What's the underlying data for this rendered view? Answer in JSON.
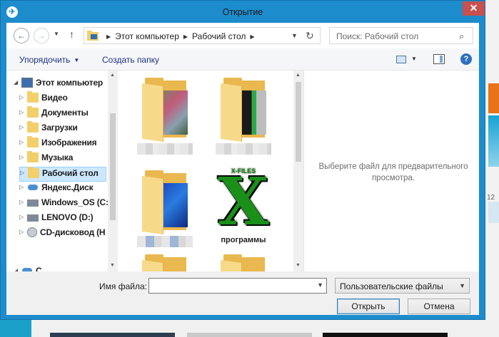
{
  "window": {
    "title": "Открытие"
  },
  "address": {
    "segments": [
      "Этот компьютер",
      "Рабочий стол"
    ],
    "search_placeholder": "Поиск: Рабочий стол"
  },
  "toolbar": {
    "organize": "Упорядочить",
    "new_folder": "Создать папку"
  },
  "tree": {
    "root": "Этот компьютер",
    "items": [
      {
        "label": "Видео",
        "icon": "video-folder-icon"
      },
      {
        "label": "Документы",
        "icon": "documents-folder-icon"
      },
      {
        "label": "Загрузки",
        "icon": "downloads-folder-icon"
      },
      {
        "label": "Изображения",
        "icon": "pictures-folder-icon"
      },
      {
        "label": "Музыка",
        "icon": "music-folder-icon"
      },
      {
        "label": "Рабочий стол",
        "icon": "desktop-folder-icon",
        "selected": true
      },
      {
        "label": "Яндекс.Диск",
        "icon": "cloud-icon"
      },
      {
        "label": "Windows_OS (C:",
        "icon": "drive-icon"
      },
      {
        "label": "LENOVO (D:)",
        "icon": "drive-icon"
      },
      {
        "label": "CD-дисковод (H",
        "icon": "cd-drive-icon"
      }
    ],
    "partial_label": "С"
  },
  "files": [
    {
      "label": "",
      "kind": "folder-photos"
    },
    {
      "label": "",
      "kind": "folder-dark"
    },
    {
      "label": "",
      "kind": "folder-windows"
    },
    {
      "label": "программы",
      "kind": "x-files-icon",
      "icon_text": "X-FILES"
    }
  ],
  "preview": {
    "text": "Выберите файл для предварительного просмотра."
  },
  "bottom": {
    "filename_label": "Имя файла:",
    "filename_value": "",
    "filetype": "Пользовательские файлы",
    "open_button": "Открыть",
    "cancel_button": "Отмена"
  },
  "background": {
    "number": "12"
  },
  "colors": {
    "titlebar": "#1c8ccc",
    "close": "#c75050",
    "selection": "#cce8ff",
    "link": "#1e3287"
  }
}
